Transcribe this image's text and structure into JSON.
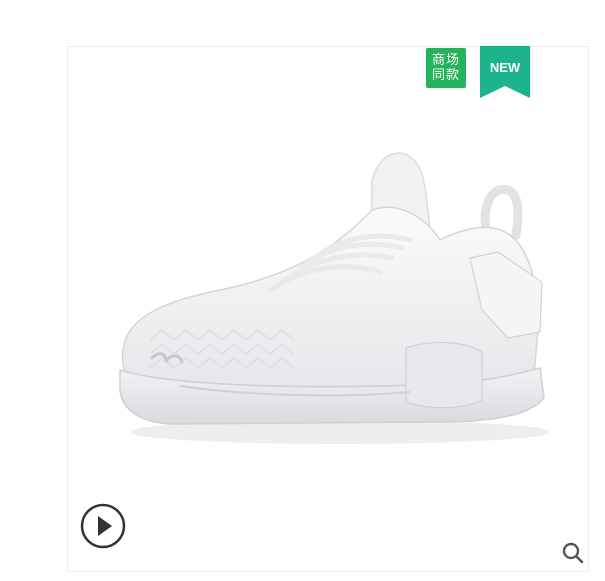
{
  "badges": {
    "store_line1": "商场",
    "store_line2": "同款",
    "new_label": "NEW"
  },
  "colors": {
    "store_badge": "#23b35a",
    "new_badge": "#1db38c",
    "play_icon": "#333333",
    "zoom_icon": "#555555"
  },
  "icons": {
    "play": "play-circle-icon",
    "zoom": "magnifier-icon"
  }
}
